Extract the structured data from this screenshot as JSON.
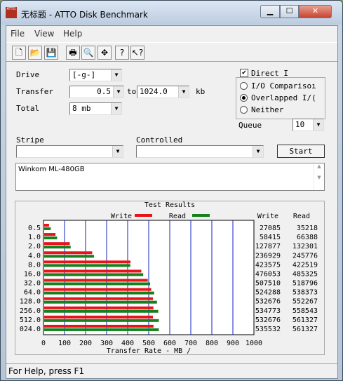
{
  "window": {
    "app_icon_text": "ATTO",
    "title": "无标题 - ATTO Disk Benchmark",
    "minimize": "▁",
    "maximize": "☐",
    "close": "✕"
  },
  "menu": {
    "file": "File",
    "view": "View",
    "help": "Help"
  },
  "toolbar": [
    "new-icon",
    "open-icon",
    "save-icon",
    "print-icon",
    "print-preview-icon",
    "move-icon",
    "help-icon",
    "context-help-icon"
  ],
  "form": {
    "drive_label": "Drive",
    "drive_value": "[-g-]",
    "transfer_label": "Transfer",
    "transfer_from": "0.5",
    "transfer_to_word": "to",
    "transfer_to": "1024.0",
    "transfer_unit": "kb",
    "total_label": "Total",
    "total_value": "8 mb",
    "direct_io_label": "Direct I",
    "direct_io_checked": true,
    "io_comparison_label": "I/O Comparisoı",
    "overlapped_io_label": "Overlapped I/(",
    "neither_label": "Neither",
    "queue_label": "Queue",
    "queue_value": "10",
    "stripe_label": "Stripe",
    "stripe_value": "",
    "controlled_label": "Controlled",
    "controlled_value": "",
    "start_label": "Start",
    "description": "Winkom ML-480GB"
  },
  "status": "For Help, press F1",
  "chart_data": {
    "type": "bar",
    "title": "Test Results",
    "xlabel": "Transfer Rate - MB /",
    "xlim": [
      0,
      1000
    ],
    "xticks": [
      "0",
      "100",
      "200",
      "300",
      "400",
      "500",
      "600",
      "700",
      "800",
      "900",
      "1000"
    ],
    "legend_position": "top",
    "grid": true,
    "write_color": "#e8141c",
    "read_color": "#16801e",
    "col_write_header": "Write",
    "col_read_header": "Read",
    "categories": [
      "0.5",
      "1.0",
      "2.0",
      "4.0",
      "8.0",
      "16.0",
      "32.0",
      "64.0",
      "128.0",
      "256.0",
      "512.0",
      "024.0"
    ],
    "series": [
      {
        "name": "Write",
        "values": [
          27085,
          58415,
          127877,
          236929,
          423575,
          476053,
          507510,
          524288,
          532676,
          534773,
          532676,
          535532
        ]
      },
      {
        "name": "Read",
        "values": [
          35218,
          66388,
          132301,
          245776,
          422519,
          485325,
          518796,
          538373,
          552267,
          558543,
          561327,
          561327
        ]
      }
    ]
  }
}
